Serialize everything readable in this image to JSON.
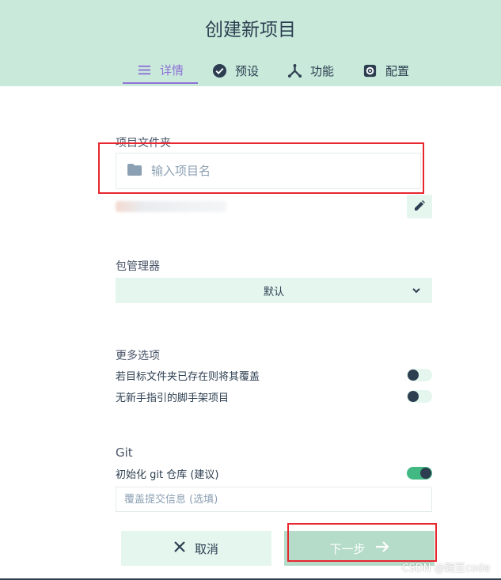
{
  "header": {
    "title": "创建新项目",
    "tabs": [
      {
        "label": "详情",
        "icon": "list-icon",
        "active": true
      },
      {
        "label": "预设",
        "icon": "check-circle-icon",
        "active": false
      },
      {
        "label": "功能",
        "icon": "fork-icon",
        "active": false
      },
      {
        "label": "配置",
        "icon": "gear-icon",
        "active": false
      }
    ]
  },
  "project_folder": {
    "label": "项目文件夹",
    "placeholder": "输入项目名",
    "icon": "folder-icon",
    "edit_icon": "pencil-icon"
  },
  "package_manager": {
    "label": "包管理器",
    "selected": "默认"
  },
  "more_options": {
    "label": "更多选项",
    "items": [
      {
        "label": "若目标文件夹已存在则将其覆盖",
        "enabled": false
      },
      {
        "label": "无新手指引的脚手架项目",
        "enabled": false
      }
    ]
  },
  "git": {
    "label": "Git",
    "init_label": "初始化 git 仓库 (建议)",
    "init_enabled": true,
    "commit_placeholder": "覆盖提交信息 (选填)"
  },
  "footer": {
    "cancel_label": "取消",
    "next_label": "下一步"
  },
  "watermark": "CSDN @豌豆code",
  "colors": {
    "header_bg": "#c9eadb",
    "accent": "#42b983",
    "active_tab": "#8e71d6",
    "annotation": "#e8262f"
  }
}
